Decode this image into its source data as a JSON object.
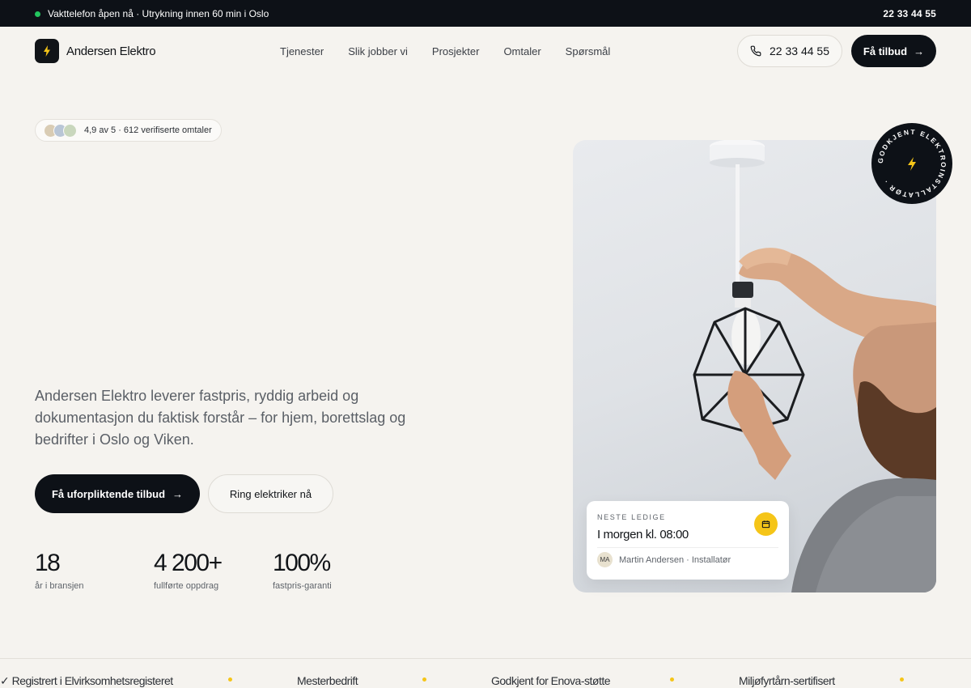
{
  "topbar": {
    "status_text": "Vakttelefon åpen nå · Utrykning innen 60 min i Oslo",
    "phone": "22 33 44 55"
  },
  "brand": {
    "name": "Andersen Elektro",
    "icon": "lightning-bolt-icon"
  },
  "nav": {
    "items": [
      "Tjenester",
      "Slik jobber vi",
      "Prosjekter",
      "Omtaler",
      "Spørsmål"
    ],
    "phone_button": "22 33 44 55",
    "quote_button": "Få tilbud",
    "arrow": "→"
  },
  "rating": {
    "text": "4,9 av 5 · 612 verifiserte omtaler",
    "avatar_colors": [
      "#d9ccb4",
      "#b9c6d6",
      "#c9d7bd"
    ]
  },
  "hero": {
    "lead": "Andersen Elektro leverer fastpris, ryddig arbeid og dokumentasjon du faktisk forstår – for hjem, borettslag og bedrifter i Oslo og Viken.",
    "cta_primary": "Få uforpliktende tilbud",
    "cta_secondary": "Ring elektriker nå",
    "arrow": "→"
  },
  "stats": [
    {
      "value": "18",
      "label": "år i bransjen"
    },
    {
      "value": "4 200+",
      "label": "fullførte oppdrag"
    },
    {
      "value": "100%",
      "label": "fastpris-garanti"
    }
  ],
  "badge": {
    "ring_text": "GODKJENT ELEKTROINSTALLATØR · ",
    "icon": "lightning-bolt-icon"
  },
  "availability": {
    "eyebrow": "NESTE LEDIGE",
    "time": "I morgen kl. 08:00",
    "initials": "MA",
    "person": "Martin Andersen · Installatør",
    "icon": "calendar-icon"
  },
  "ticker": [
    "✓ Registrert i Elvirksomhetsregisteret",
    "Mesterbedrift",
    "Godkjent for Enova-støtte",
    "Miljøfyrtårn-sertifisert"
  ],
  "colors": {
    "dark": "#0d1117",
    "accent": "#f5c518",
    "background": "#f5f3ef",
    "online": "#22c55e"
  }
}
